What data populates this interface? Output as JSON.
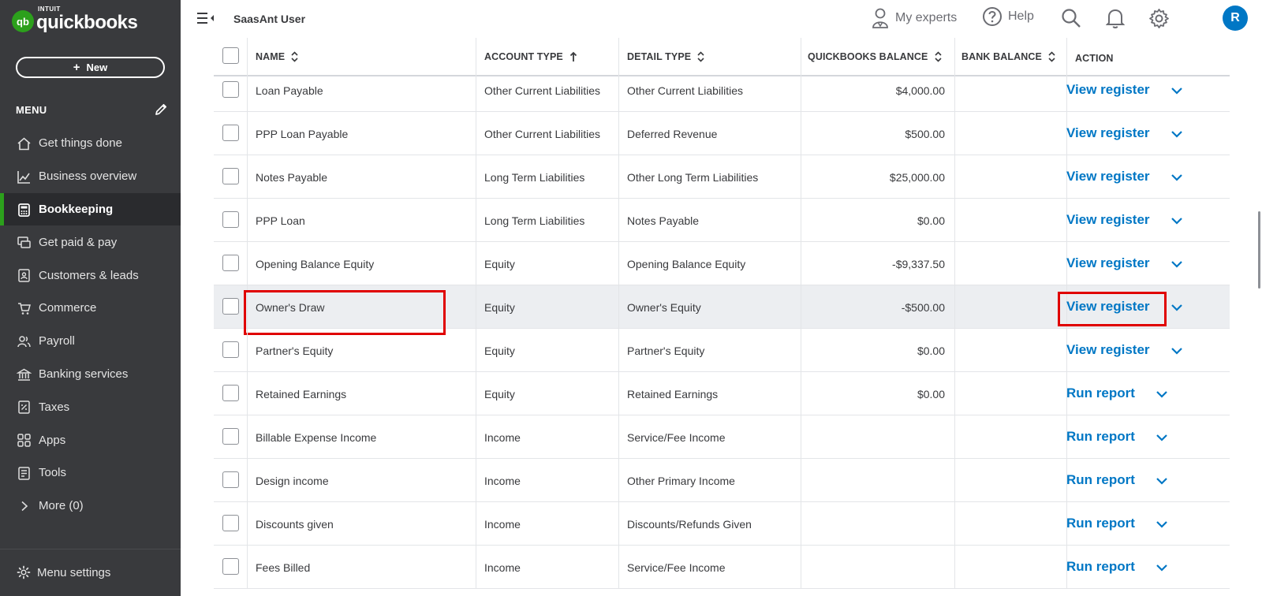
{
  "brand": {
    "small": "INTUIT",
    "name": "quickbooks",
    "logo_glyph": "qb",
    "color": "#2ca01c"
  },
  "sidebar": {
    "new_button": "New",
    "menu_label": "MENU",
    "items": [
      {
        "label": "Get things done",
        "icon": "home-icon"
      },
      {
        "label": "Business overview",
        "icon": "chart-icon"
      },
      {
        "label": "Bookkeeping",
        "icon": "calculator-icon",
        "active": true
      },
      {
        "label": "Get paid & pay",
        "icon": "payment-icon"
      },
      {
        "label": "Customers & leads",
        "icon": "contacts-icon"
      },
      {
        "label": "Commerce",
        "icon": "cart-icon"
      },
      {
        "label": "Payroll",
        "icon": "people-icon"
      },
      {
        "label": "Banking services",
        "icon": "bank-icon"
      },
      {
        "label": "Taxes",
        "icon": "taxes-icon"
      },
      {
        "label": "Apps",
        "icon": "apps-icon"
      },
      {
        "label": "Tools",
        "icon": "tools-icon"
      },
      {
        "label": "More (0)",
        "icon": "chevron-right-icon"
      }
    ],
    "menu_settings": "Menu settings"
  },
  "topbar": {
    "company": "SaasAnt User",
    "my_experts": "My experts",
    "help": "Help",
    "avatar_initial": "R"
  },
  "table": {
    "columns": [
      "NAME",
      "ACCOUNT TYPE",
      "DETAIL TYPE",
      "QUICKBOOKS BALANCE",
      "BANK BALANCE",
      "ACTION"
    ],
    "rows": [
      {
        "name": "Loan Payable",
        "type": "Other Current Liabilities",
        "detail": "Other Current Liabilities",
        "qb_balance": "$4,000.00",
        "bank_balance": "",
        "action": "View register"
      },
      {
        "name": "PPP Loan Payable",
        "type": "Other Current Liabilities",
        "detail": "Deferred Revenue",
        "qb_balance": "$500.00",
        "bank_balance": "",
        "action": "View register"
      },
      {
        "name": "Notes Payable",
        "type": "Long Term Liabilities",
        "detail": "Other Long Term Liabilities",
        "qb_balance": "$25,000.00",
        "bank_balance": "",
        "action": "View register"
      },
      {
        "name": "PPP Loan",
        "type": "Long Term Liabilities",
        "detail": "Notes Payable",
        "qb_balance": "$0.00",
        "bank_balance": "",
        "action": "View register"
      },
      {
        "name": "Opening Balance Equity",
        "type": "Equity",
        "detail": "Opening Balance Equity",
        "qb_balance": "-$9,337.50",
        "bank_balance": "",
        "action": "View register"
      },
      {
        "name": "Owner's Draw",
        "type": "Equity",
        "detail": "Owner's Equity",
        "qb_balance": "-$500.00",
        "bank_balance": "",
        "action": "View register",
        "highlight": true
      },
      {
        "name": "Partner's Equity",
        "type": "Equity",
        "detail": "Partner's Equity",
        "qb_balance": "$0.00",
        "bank_balance": "",
        "action": "View register"
      },
      {
        "name": "Retained Earnings",
        "type": "Equity",
        "detail": "Retained Earnings",
        "qb_balance": "$0.00",
        "bank_balance": "",
        "action": "Run report"
      },
      {
        "name": "Billable Expense Income",
        "type": "Income",
        "detail": "Service/Fee Income",
        "qb_balance": "",
        "bank_balance": "",
        "action": "Run report"
      },
      {
        "name": "Design income",
        "type": "Income",
        "detail": "Other Primary Income",
        "qb_balance": "",
        "bank_balance": "",
        "action": "Run report"
      },
      {
        "name": "Discounts given",
        "type": "Income",
        "detail": "Discounts/Refunds Given",
        "qb_balance": "",
        "bank_balance": "",
        "action": "Run report"
      },
      {
        "name": "Fees Billed",
        "type": "Income",
        "detail": "Service/Fee Income",
        "qb_balance": "",
        "bank_balance": "",
        "action": "Run report"
      }
    ]
  },
  "colors": {
    "link": "#0077c5",
    "sidebar_bg": "#393a3d",
    "highlight_box": "#e00000",
    "row_highlight": "#eceef1"
  }
}
